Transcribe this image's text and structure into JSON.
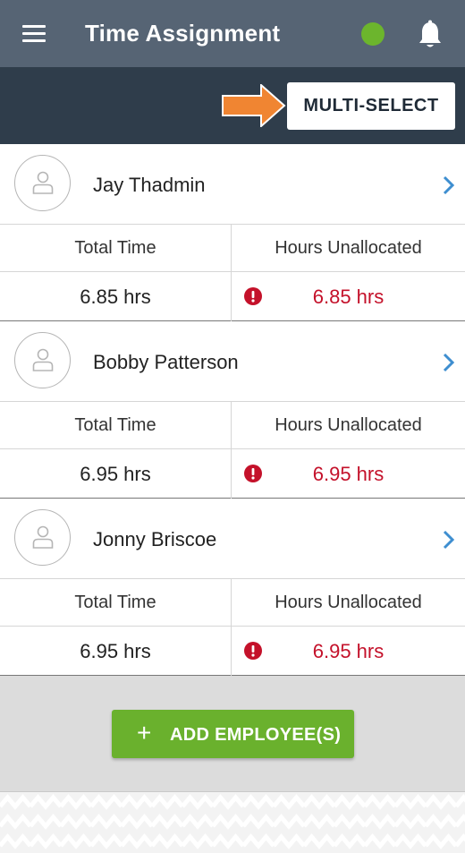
{
  "header": {
    "title": "Time Assignment",
    "status_color": "#6cb52d",
    "icons": [
      "menu-icon",
      "bell-icon"
    ]
  },
  "toolbar": {
    "multi_select_label": "MULTI-SELECT",
    "arrow_color": "#f08532"
  },
  "columns": {
    "total_time": "Total Time",
    "hours_unallocated": "Hours Unallocated"
  },
  "employees": [
    {
      "name": "Jay Thadmin",
      "total_time": "6.85 hrs",
      "unallocated": "6.85 hrs"
    },
    {
      "name": "Bobby Patterson",
      "total_time": "6.95 hrs",
      "unallocated": "6.95 hrs"
    },
    {
      "name": "Jonny Briscoe",
      "total_time": "6.95 hrs",
      "unallocated": "6.95 hrs"
    }
  ],
  "footer": {
    "add_button_icon": "+",
    "add_button_label": "ADD EMPLOYEE(S)"
  },
  "colors": {
    "header_bg": "#566474",
    "subbar_bg": "#2f3d4b",
    "accent_blue": "#3e8ed0",
    "alert_red": "#c4112a",
    "button_green": "#6ab12d"
  }
}
